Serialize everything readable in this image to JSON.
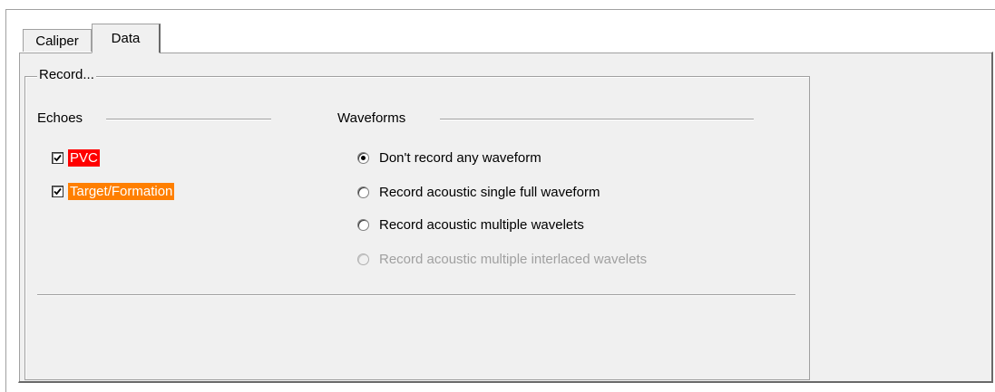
{
  "tabs": [
    {
      "label": "Caliper",
      "active": false
    },
    {
      "label": "Data",
      "active": true
    }
  ],
  "record_group": {
    "title": "Record...",
    "echoes": {
      "title": "Echoes",
      "items": [
        {
          "label": "PVC",
          "checked": true,
          "highlight_color": "#ff0000"
        },
        {
          "label": "Target/Formation",
          "checked": true,
          "highlight_color": "#ff7f00"
        }
      ]
    },
    "waveforms": {
      "title": "Waveforms",
      "options": [
        {
          "label": "Don't record any waveform",
          "selected": true,
          "enabled": true
        },
        {
          "label": "Record acoustic single full waveform",
          "selected": false,
          "enabled": true
        },
        {
          "label": "Record acoustic multiple wavelets",
          "selected": false,
          "enabled": true
        },
        {
          "label": "Record acoustic multiple interlaced wavelets",
          "selected": false,
          "enabled": false
        }
      ]
    }
  },
  "colors": {
    "window_bg": "#f0f0f0",
    "border": "#a0a0a0",
    "pvc_highlight": "#ff0000",
    "target_highlight": "#ff7f00",
    "disabled_text": "#a0a0a0"
  }
}
